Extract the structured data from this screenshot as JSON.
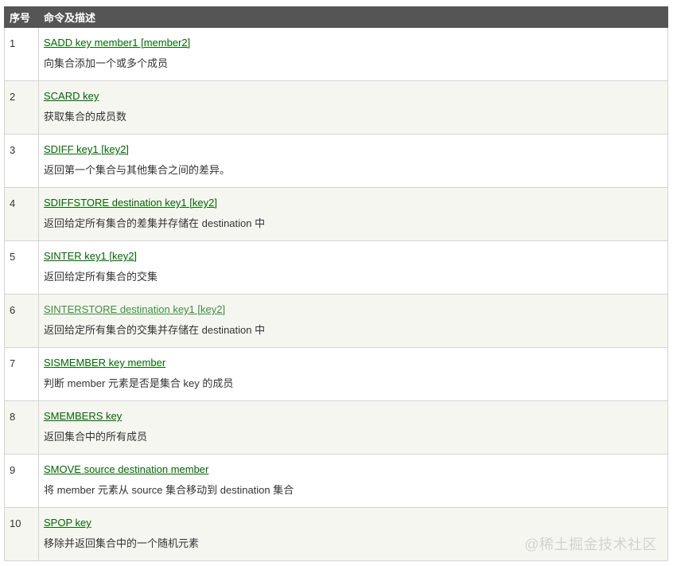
{
  "table": {
    "header": {
      "number": "序号",
      "command": "命令及描述"
    },
    "rows": [
      {
        "number": "1",
        "command": "SADD key member1 [member2]",
        "description": "向集合添加一个或多个成员"
      },
      {
        "number": "2",
        "command": "SCARD key",
        "description": "获取集合的成员数"
      },
      {
        "number": "3",
        "command": "SDIFF key1 [key2]",
        "description": "返回第一个集合与其他集合之间的差异。"
      },
      {
        "number": "4",
        "command": "SDIFFSTORE destination key1 [key2]",
        "description": "返回给定所有集合的差集并存储在 destination 中"
      },
      {
        "number": "5",
        "command": "SINTER key1 [key2]",
        "description": "返回给定所有集合的交集"
      },
      {
        "number": "6",
        "command": "SINTERSTORE destination key1 [key2]",
        "description": "返回给定所有集合的交集并存储在 destination 中"
      },
      {
        "number": "7",
        "command": "SISMEMBER key member",
        "description": "判断 member 元素是否是集合 key 的成员"
      },
      {
        "number": "8",
        "command": "SMEMBERS key",
        "description": "返回集合中的所有成员"
      },
      {
        "number": "9",
        "command": "SMOVE source destination member",
        "description": "将 member 元素从 source 集合移动到 destination 集合"
      },
      {
        "number": "10",
        "command": "SPOP key",
        "description": "移除并返回集合中的一个随机元素"
      }
    ]
  },
  "watermark": "@稀土掘金技术社区",
  "colors": {
    "header_bg": "#555555",
    "link": "#006600",
    "link_visited": "#3d8f3d",
    "row_alt_bg": "#f6f6f1"
  }
}
